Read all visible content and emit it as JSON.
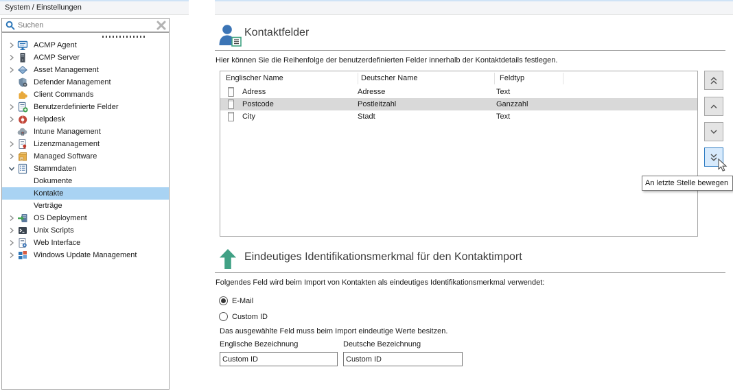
{
  "sidebar": {
    "header": "System / Einstellungen",
    "search": {
      "placeholder": "Suchen"
    },
    "tree": [
      {
        "label": "ACMP Agent",
        "icon": "monitor",
        "expand": "collapsed"
      },
      {
        "label": "ACMP Server",
        "icon": "server-tower",
        "expand": "collapsed"
      },
      {
        "label": "Asset Management",
        "icon": "diamond",
        "expand": "collapsed"
      },
      {
        "label": "Defender Management",
        "icon": "shield-gear",
        "expand": "none"
      },
      {
        "label": "Client Commands",
        "icon": "puzzle",
        "expand": "none"
      },
      {
        "label": "Benutzerdefinierte Felder",
        "icon": "table-plus",
        "expand": "collapsed"
      },
      {
        "label": "Helpdesk",
        "icon": "lifebuoy",
        "expand": "collapsed"
      },
      {
        "label": "Intune Management",
        "icon": "cloud-server",
        "expand": "none"
      },
      {
        "label": "Lizenzmanagement",
        "icon": "document-seal",
        "expand": "collapsed"
      },
      {
        "label": "Managed Software",
        "icon": "software-box",
        "expand": "collapsed"
      },
      {
        "label": "Stammdaten",
        "icon": "list-sheet",
        "expand": "expanded"
      },
      {
        "label": "Dokumente",
        "child": true
      },
      {
        "label": "Kontakte",
        "child": true,
        "selected": true
      },
      {
        "label": "Verträge",
        "child": true
      },
      {
        "label": "OS Deployment",
        "icon": "deploy-server",
        "expand": "collapsed"
      },
      {
        "label": "Unix Scripts",
        "icon": "terminal",
        "expand": "collapsed"
      },
      {
        "label": "Web Interface",
        "icon": "document-gear",
        "expand": "collapsed"
      },
      {
        "label": "Windows Update Management",
        "icon": "windows-grid",
        "expand": "collapsed"
      }
    ]
  },
  "main": {
    "contact_fields": {
      "title": "Kontaktfelder",
      "description": "Hier können Sie die Reihenfolge der benutzerdefinierten Felder innerhalb der Kontaktdetails festlegen.",
      "table": {
        "columns": [
          "Englischer Name",
          "Deutscher Name",
          "Feldtyp"
        ],
        "rows": [
          {
            "en": "Adress",
            "de": "Adresse",
            "type": "Text"
          },
          {
            "en": "Postcode",
            "de": "Postleitzahl",
            "type": "Ganzzahl",
            "selected": true
          },
          {
            "en": "City",
            "de": "Stadt",
            "type": "Text"
          }
        ]
      },
      "move_buttons": [
        {
          "name": "move-to-first"
        },
        {
          "name": "move-up"
        },
        {
          "name": "move-down"
        },
        {
          "name": "move-to-last",
          "hovered": true
        }
      ],
      "tooltip": "An letzte Stelle bewegen"
    },
    "identification": {
      "title": "Eindeutiges Identifikationsmerkmal für den Kontaktimport",
      "description": "Folgendes Feld wird beim Import von Kontakten als eindeutiges Identifikationsmerkmal verwendet:",
      "options": [
        {
          "label": "E-Mail",
          "checked": true
        },
        {
          "label": "Custom ID",
          "checked": false
        }
      ],
      "note": "Das ausgewählte Feld muss beim Import eindeutige Werte besitzen.",
      "fields": [
        {
          "label": "Englische Bezeichnung",
          "value": "Custom ID"
        },
        {
          "label": "Deutsche Bezeichnung",
          "value": "Custom ID"
        }
      ]
    }
  },
  "colors": {
    "tree_selection": "#a9d3f3",
    "row_selection": "#d9d9d9",
    "hover_button_border": "#2e7cc2",
    "accent_blue": "#3b74b5",
    "accent_green": "#41a185"
  }
}
